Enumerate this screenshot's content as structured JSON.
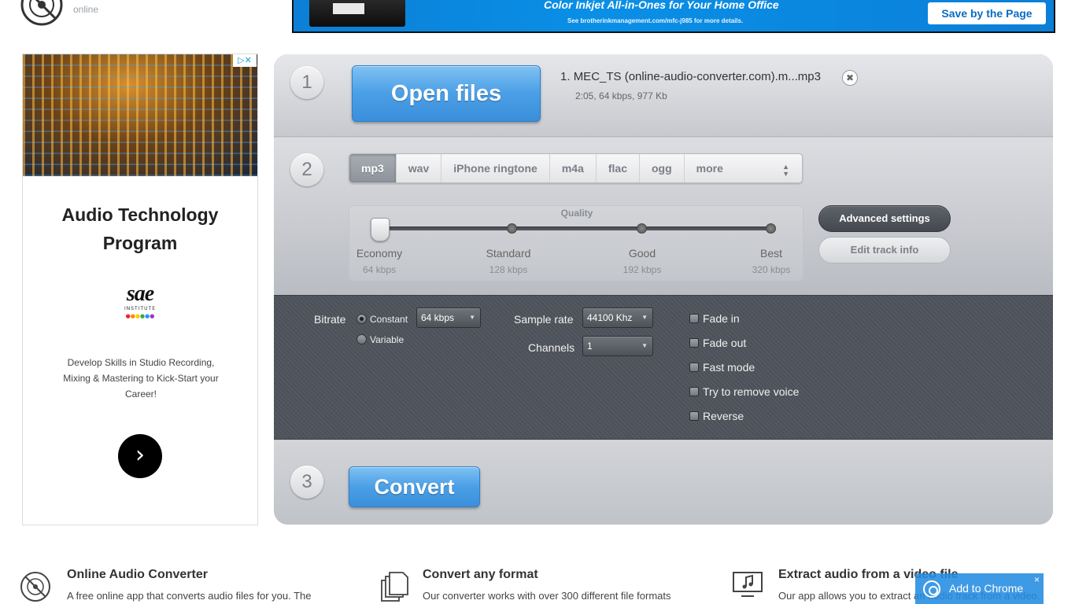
{
  "header": {
    "logo_subtitle": "online",
    "icons": {
      "logo": "disc-icon"
    }
  },
  "top_ad": {
    "headline": "Color Inkjet All-in-Ones for Your Home Office",
    "fine_print": "See brotherinkmanagement.com/mfc-j985 for more details.",
    "cta": "Save by the Page"
  },
  "side_ad": {
    "adchoices": "▷✕",
    "title": "Audio Technology Program",
    "brand_mark": "sae",
    "brand_sub": "INSTITUTE",
    "description": "Develop Skills in Studio Recording, Mixing & Mastering to Kick-Start your Career!",
    "go_arrow": "›"
  },
  "steps": {
    "one": "1",
    "two": "2",
    "three": "3"
  },
  "open_files": {
    "label": "Open files",
    "file_index": "1.",
    "file_name": "MEC_TS (online-audio-converter.com).m...mp3",
    "file_meta": "2:05, 64 kbps, 977 Kb",
    "remove_icon": "✖"
  },
  "formats": {
    "tabs": [
      "mp3",
      "wav",
      "iPhone ringtone",
      "m4a",
      "flac",
      "ogg",
      "more"
    ],
    "active": "mp3",
    "more_arrows": "▲▼"
  },
  "quality": {
    "label": "Quality",
    "selected_level": 0,
    "levels": [
      {
        "name": "Economy",
        "rate": "64 kbps"
      },
      {
        "name": "Standard",
        "rate": "128 kbps"
      },
      {
        "name": "Good",
        "rate": "192 kbps"
      },
      {
        "name": "Best",
        "rate": "320 kbps"
      }
    ]
  },
  "side_buttons": {
    "advanced": "Advanced settings",
    "edit_track": "Edit track info"
  },
  "advanced": {
    "bitrate_label": "Bitrate",
    "constant_label": "Constant",
    "variable_label": "Variable",
    "bitrate_mode": "Constant",
    "bitrate_value": "64 kbps",
    "sample_rate_label": "Sample rate",
    "sample_rate_value": "44100 Khz",
    "channels_label": "Channels",
    "channels_value": "1",
    "options": [
      "Fade in",
      "Fade out",
      "Fast mode",
      "Try to remove voice",
      "Reverse"
    ]
  },
  "convert": {
    "label": "Convert"
  },
  "features": [
    {
      "title": "Online Audio Converter",
      "text": "A free online app that converts audio files for you. The",
      "icon": "disc-icon"
    },
    {
      "title": "Convert any format",
      "text": "Our converter works with over 300 different file formats",
      "icon": "files-icon"
    },
    {
      "title": "Extract audio from a video file",
      "text": "Our app allows you to extract an audio track from a video.",
      "icon": "video-music-icon"
    }
  ],
  "chrome_popup": {
    "label": "Add to Chrome",
    "close": "×"
  },
  "colors": {
    "accent_blue": "#4a9fe6",
    "panel_gray": "#c9cbd0",
    "advanced_bg": "#50555c"
  }
}
